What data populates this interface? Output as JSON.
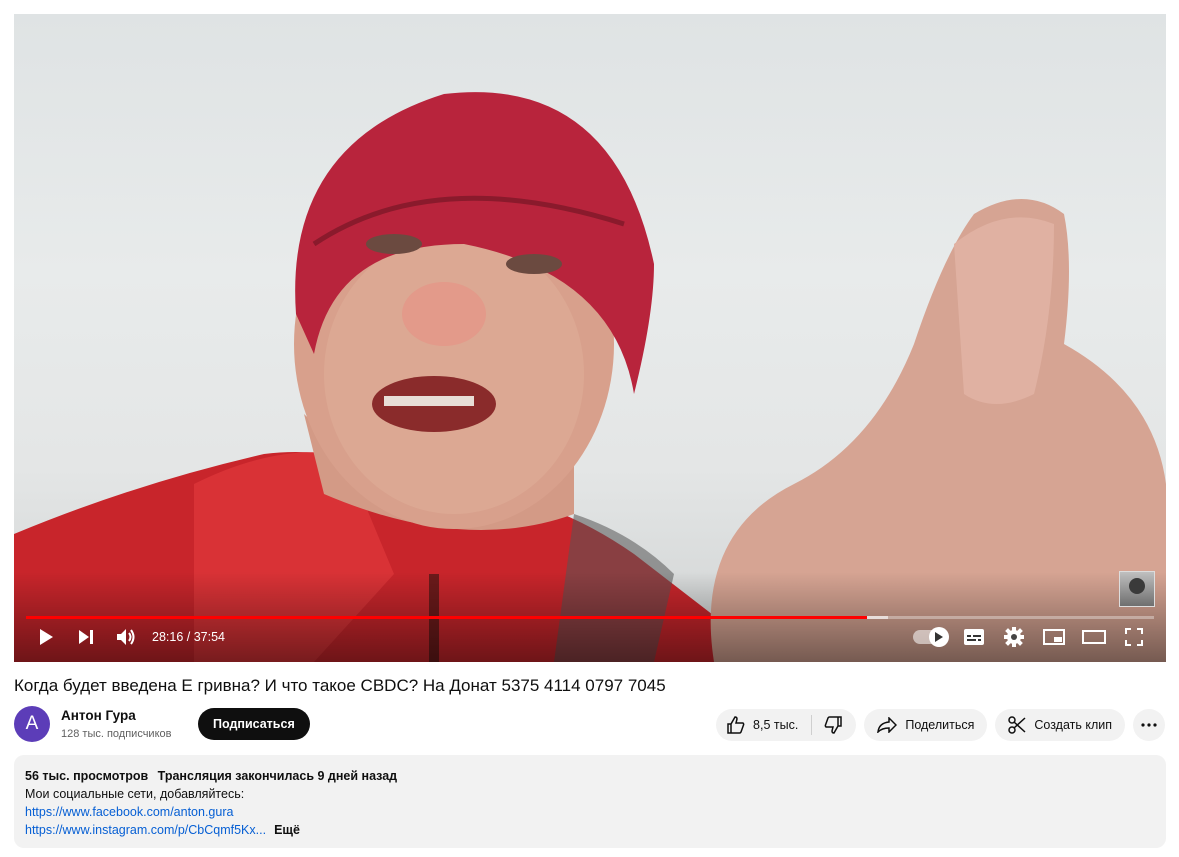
{
  "player": {
    "current_time": "28:16",
    "duration": "37:54",
    "time_display": "28:16 / 37:54",
    "progress_played": 0.746,
    "progress_loaded": 0.764,
    "icons": [
      "play-icon",
      "next-icon",
      "volume-icon",
      "autoplay-toggle-icon",
      "subtitles-icon",
      "settings-icon",
      "miniplayer-icon",
      "theater-icon",
      "fullscreen-icon"
    ]
  },
  "video": {
    "title": "Когда будет введена Е гривна? И что такое CBDC? На Донат 5375 4114 0797 7045"
  },
  "channel": {
    "avatar_letter": "A",
    "name": "Антон Гура",
    "subscribers": "128 тыс. подписчиков",
    "subscribe_label": "Подписаться"
  },
  "actions": {
    "likes": "8,5 тыс.",
    "share_label": "Поделиться",
    "clip_label": "Создать клип"
  },
  "description": {
    "views": "56 тыс. просмотров",
    "stream_info": "Трансляция закончилась 9 дней назад",
    "line1": "Мои социальные сети, добавляйтесь:",
    "link1": "https://www.facebook.com/anton.gura",
    "link2": "https://www.instagram.com/p/CbCqmf5Kx...",
    "more_label": "Ещё"
  },
  "colors": {
    "progress": "#ff0000",
    "avatar": "#5c3db8",
    "link": "#065fd4"
  }
}
